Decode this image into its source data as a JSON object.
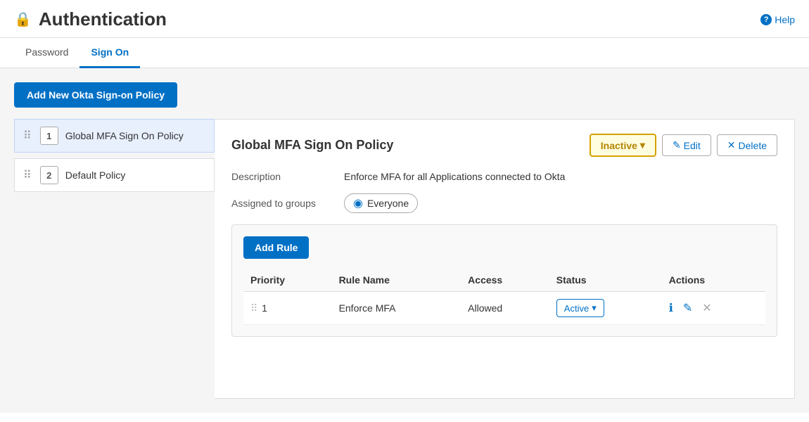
{
  "header": {
    "title": "Authentication",
    "help_label": "Help",
    "lock_icon": "🔒"
  },
  "tabs": [
    {
      "id": "password",
      "label": "Password"
    },
    {
      "id": "sign-on",
      "label": "Sign On"
    }
  ],
  "active_tab": "sign-on",
  "toolbar": {
    "add_policy_label": "Add New Okta Sign-on Policy"
  },
  "sidebar": {
    "items": [
      {
        "number": "1",
        "label": "Global MFA Sign On Policy",
        "selected": true
      },
      {
        "number": "2",
        "label": "Default Policy",
        "selected": false
      }
    ]
  },
  "policy": {
    "title": "Global MFA Sign On Policy",
    "status": "Inactive",
    "edit_label": "Edit",
    "delete_label": "Delete",
    "description_label": "Description",
    "description_value": "Enforce MFA for all Applications connected to Okta",
    "groups_label": "Assigned to groups",
    "group_name": "Everyone"
  },
  "rules": {
    "add_rule_label": "Add Rule",
    "columns": [
      "Priority",
      "Rule Name",
      "Access",
      "Status",
      "Actions"
    ],
    "rows": [
      {
        "priority": "1",
        "name": "Enforce MFA",
        "access": "Allowed",
        "status": "Active"
      }
    ]
  }
}
